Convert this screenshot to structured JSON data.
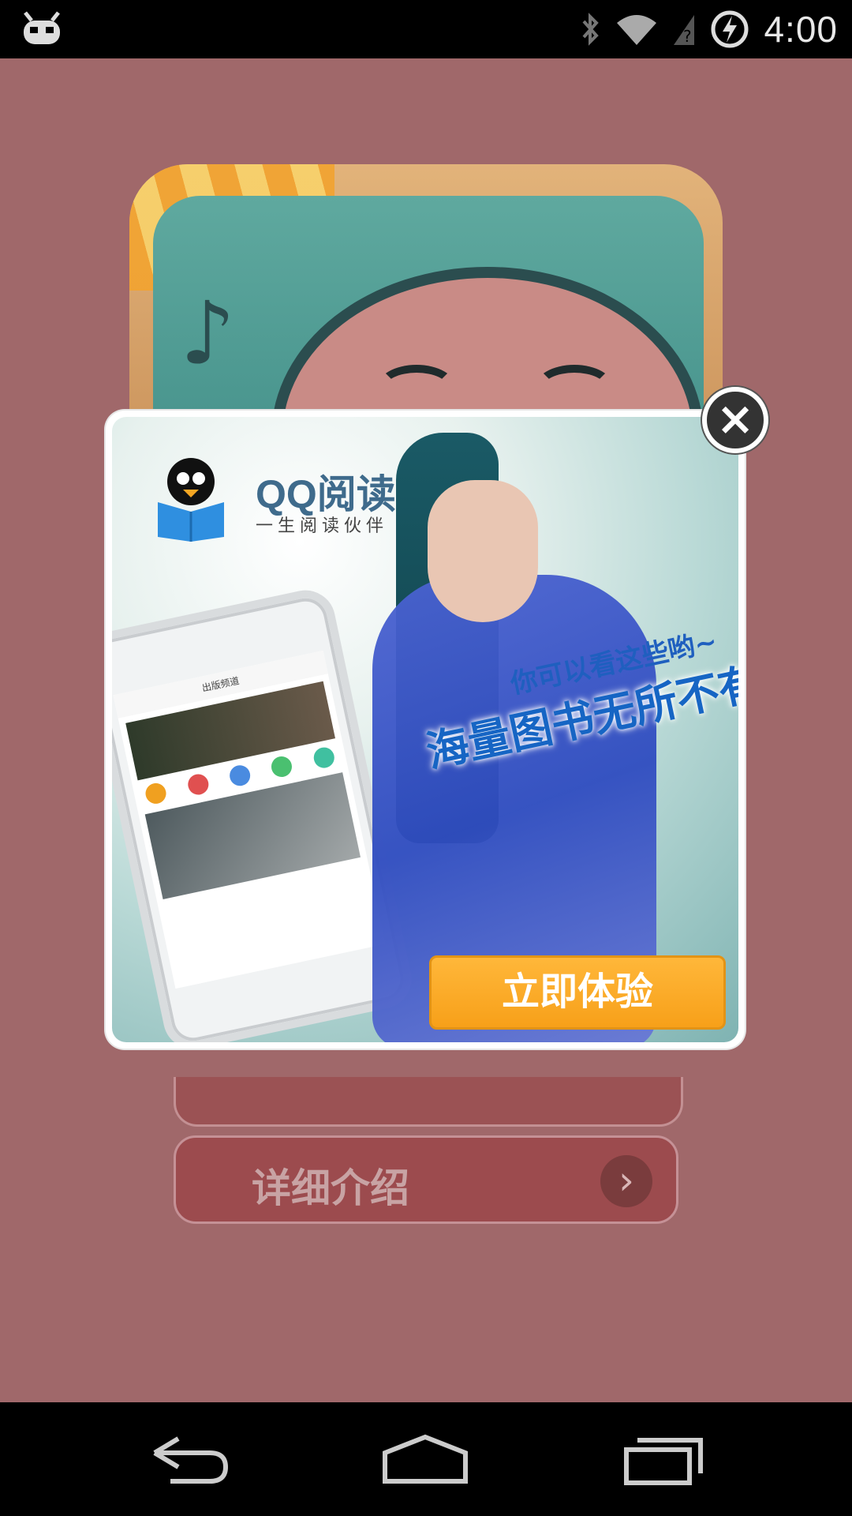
{
  "status_bar": {
    "time": "4:00",
    "icons": [
      "notification-bot-icon",
      "bluetooth-icon",
      "wifi-icon",
      "no-signal-icon",
      "battery-charging-icon"
    ]
  },
  "background_app": {
    "detail_button_label": "详细介绍",
    "carousel_page_count": 2,
    "carousel_active_index": 0
  },
  "ad": {
    "brand_name": "QQ阅读",
    "brand_tagline": "一生阅读伙伴",
    "headline_small": "你可以看这些哟~",
    "headline_large": "海量图书无所不有",
    "cta_label": "立即体验",
    "close_label": "×",
    "phone_header": "出版频道"
  },
  "nav_bar": {
    "icons": [
      "back-icon",
      "home-icon",
      "recents-icon"
    ]
  },
  "colors": {
    "background": "#a0686a",
    "cta": "#f7a019",
    "active_dot": "#f7a12b"
  }
}
